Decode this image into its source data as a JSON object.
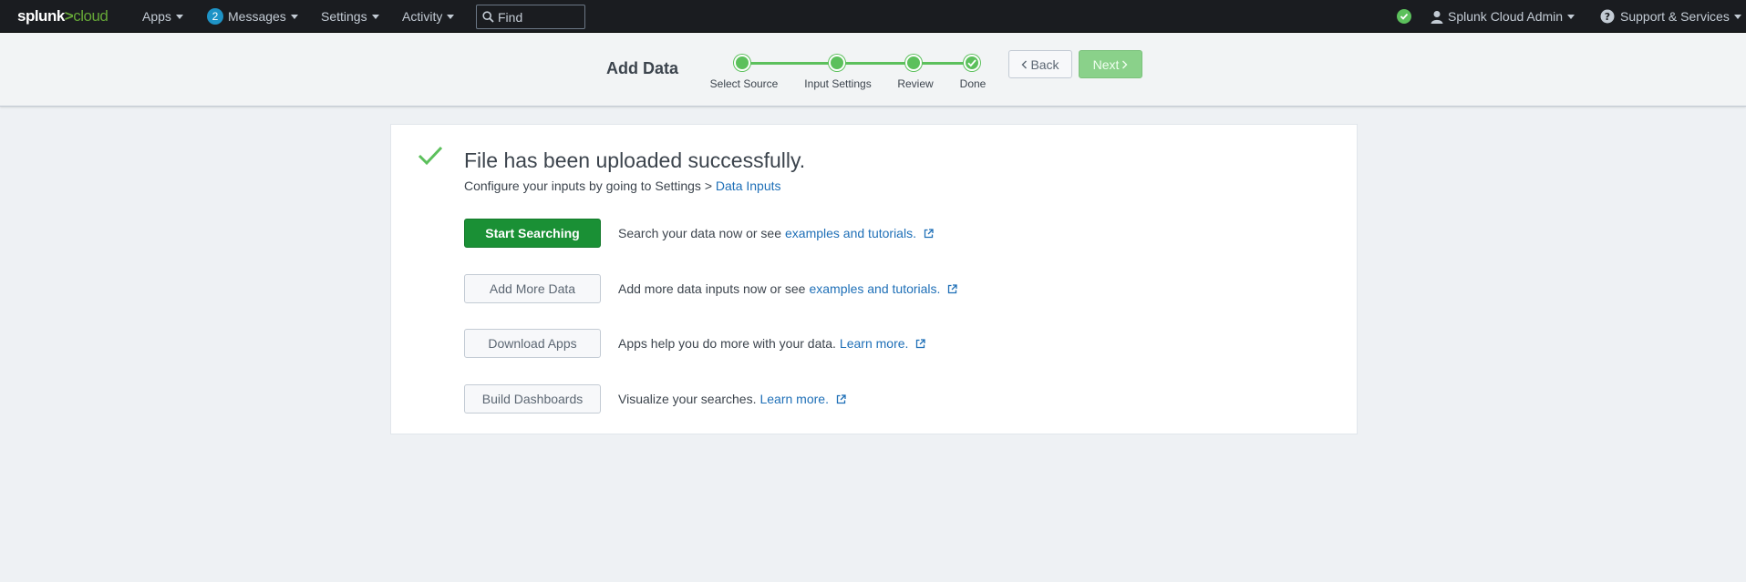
{
  "nav": {
    "logo_part1": "splunk",
    "logo_part2": ">",
    "logo_part3": "cloud",
    "apps": "Apps",
    "messages_count": "2",
    "messages": "Messages",
    "settings": "Settings",
    "activity": "Activity",
    "find_placeholder": "Find",
    "user": "Splunk Cloud Admin",
    "support": "Support & Services"
  },
  "wizard": {
    "title": "Add Data",
    "steps": [
      {
        "label": "Select Source"
      },
      {
        "label": "Input Settings"
      },
      {
        "label": "Review"
      },
      {
        "label": "Done"
      }
    ],
    "back_label": "Back",
    "next_label": "Next"
  },
  "result": {
    "headline": "File has been uploaded successfully.",
    "sub_text": "Configure your inputs by going to Settings > ",
    "sub_link": "Data Inputs",
    "actions": [
      {
        "button": "Start Searching",
        "text": "Search your data now or see ",
        "link": "examples and tutorials."
      },
      {
        "button": "Add More Data",
        "text": "Add more data inputs now or see ",
        "link": "examples and tutorials."
      },
      {
        "button": "Download Apps",
        "text": "Apps help you do more with your data. ",
        "link": "Learn more."
      },
      {
        "button": "Build Dashboards",
        "text": "Visualize your searches. ",
        "link": "Learn more."
      }
    ]
  },
  "colors": {
    "nav_bg": "#1a1c20",
    "success_green": "#5cc05c",
    "primary_button": "#1a9035",
    "link_blue": "#1e6fb7"
  }
}
